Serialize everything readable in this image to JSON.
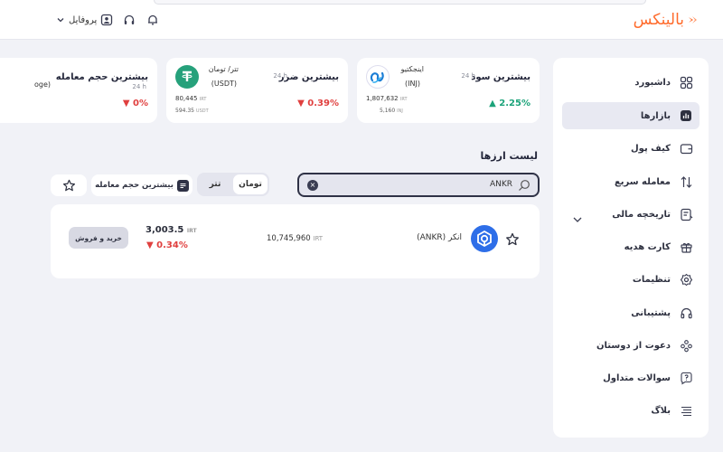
{
  "header": {
    "logo_text": "بالینکس",
    "profile_label": "پروفایل"
  },
  "sidebar": {
    "items": [
      {
        "label": "داشبورد",
        "icon": "dashboard-grid-icon"
      },
      {
        "label": "بازارها",
        "icon": "chart-icon"
      },
      {
        "label": "کیف پول",
        "icon": "wallet-icon"
      },
      {
        "label": "معامله سریع",
        "icon": "swap-arrows-icon"
      },
      {
        "label": "تاریخچه مالی",
        "icon": "history-icon"
      },
      {
        "label": "کارت هدیه",
        "icon": "gift-icon"
      },
      {
        "label": "تنظیمات",
        "icon": "gear-icon"
      },
      {
        "label": "پشتیبانی",
        "icon": "headset-icon"
      },
      {
        "label": "دعوت از دوستان",
        "icon": "users-icon"
      },
      {
        "label": "سوالات متداول",
        "icon": "question-icon"
      },
      {
        "label": "بلاگ",
        "icon": "list-icon"
      }
    ],
    "active_index": 1
  },
  "cards": [
    {
      "title": "بیشترین سود",
      "period": "24 h",
      "change": "2.25%",
      "direction": "up",
      "coin_name": "اینجکتیو",
      "coin_symbol": "(INJ)",
      "price_irt": "1,807,632",
      "price_usdt": "5,160",
      "unit_irt": "IRT",
      "unit_usdt": "INJ"
    },
    {
      "title": "بیشترین ضرر",
      "period": "24 h",
      "change": "0.39%",
      "direction": "down",
      "coin_name": "تتر/ تومان",
      "coin_symbol": "(USDT)",
      "price_irt": "80,445",
      "price_usdt": "594.35",
      "unit_irt": "IRT",
      "unit_usdt": "USDT"
    },
    {
      "title": "بیشترین حجم معامله",
      "title_cut": "بیشترین حجم معامله",
      "period": "24 h",
      "change": "0%",
      "direction": "down",
      "coin_partial": "oge)"
    }
  ],
  "list": {
    "title": "لیست ارزها",
    "search_value": "ANKR",
    "toggle": {
      "toman": "تومان",
      "tether": "تتر",
      "selected": "toman"
    },
    "sort_label": "بیشترین حجم معامله"
  },
  "rows": [
    {
      "name": "انکر",
      "symbol": "(ANKR)",
      "volume": "10,745,960",
      "volume_unit": "IRT",
      "price": "3,003.5",
      "price_unit": "IRT",
      "change": "0.34%",
      "direction": "down",
      "trade_label": "خرید و فروش"
    }
  ],
  "colors": {
    "brand": "#ff6b2c",
    "up": "#1ca37a",
    "down": "#e0403f",
    "ankr": "#2e6ee8",
    "tether": "#26a17b",
    "inj": "#1c7ed6"
  }
}
